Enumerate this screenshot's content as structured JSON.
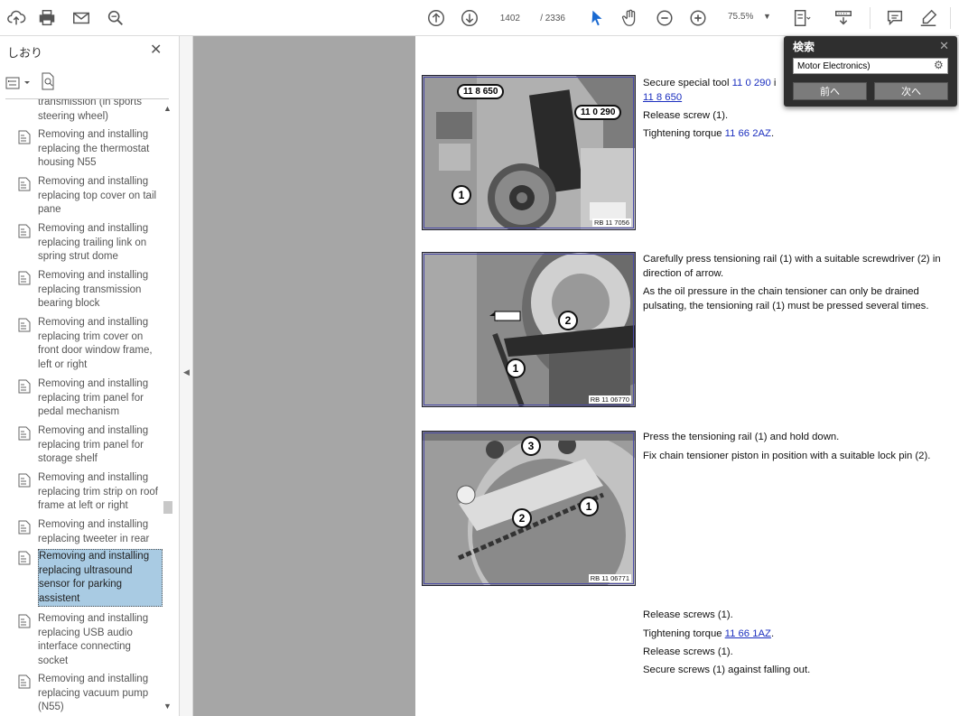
{
  "toolbar": {
    "page_current": "1402",
    "page_total": "/ 2336",
    "zoom": "75.5%",
    "zoom_dropdown": "▼"
  },
  "sidebar": {
    "title": "しおり",
    "close": "✕",
    "items": [
      {
        "label": "transmission (in sports steering wheel)"
      },
      {
        "label": "Removing and installing replacing the thermostat housing N55"
      },
      {
        "label": "Removing and installing replacing top cover on tail pane"
      },
      {
        "label": "Removing and installing replacing trailing link on spring strut dome"
      },
      {
        "label": "Removing and installing replacing transmission bearing block"
      },
      {
        "label": "Removing and installing replacing trim cover on front door window frame, left or right"
      },
      {
        "label": "Removing and installing replacing trim panel for pedal mechanism"
      },
      {
        "label": "Removing and installing replacing trim panel for storage shelf"
      },
      {
        "label": "Removing and installing replacing trim strip on roof frame at left or right"
      },
      {
        "label": "Removing and installing replacing tweeter in rear"
      },
      {
        "label": "Removing and installing replacing ultrasound sensor for parking assistent"
      },
      {
        "label": "Removing and installing replacing USB audio interface connecting socket"
      },
      {
        "label": "Removing and installing replacing vacuum pump (N55)"
      }
    ],
    "selected_index": 10
  },
  "search_panel": {
    "title": "検索",
    "close": "✕",
    "query": "Motor Electronics)",
    "prev_label": "前へ",
    "next_label": "次へ"
  },
  "document": {
    "fig1": {
      "code": "RB 11 7056",
      "tag_a": "11 8 650",
      "tag_b": "11 0 290",
      "callout": "1"
    },
    "fig2": {
      "code": "RB 11 06770",
      "callout_1": "1",
      "callout_2": "2"
    },
    "fig3": {
      "code": "RB 11 06771",
      "callout_1": "1",
      "callout_2": "2",
      "callout_3": "3"
    },
    "step1": {
      "line1_pre": "Secure special tool ",
      "line1_link": "11 0 290",
      "line1_post": " i",
      "line2_link": "11 8 650",
      "line3": "Release screw (1).",
      "line4_pre": "Tightening torque ",
      "line4_link": "11 66 2AZ",
      "line4_post": "."
    },
    "step2": {
      "p1": "Carefully press tensioning rail (1) with a suitable screwdriver (2) in direction of arrow.",
      "p2": "As the oil pressure in the chain tensioner can only be drained pulsating, the tensioning rail (1) must be pressed several times."
    },
    "step3": {
      "p1": "Press the tensioning rail (1) and hold down.",
      "p2": "Fix chain tensioner piston in position with a suitable lock pin (2)."
    },
    "step4": {
      "line1": "Release screws (1).",
      "line2_pre": "Tightening torque ",
      "line2_link": "11 66 1AZ",
      "line2_post": ".",
      "line3": "Release screws (1).",
      "line4": "Secure screws (1) against falling out."
    }
  }
}
